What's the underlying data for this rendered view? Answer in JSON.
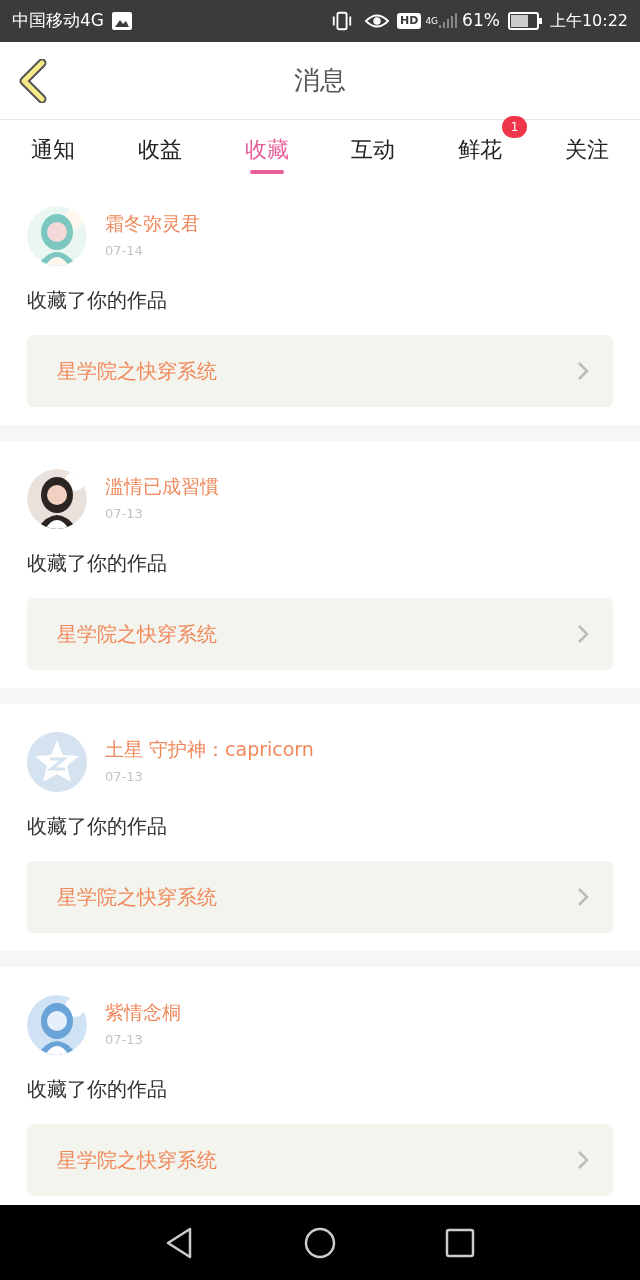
{
  "status_bar": {
    "carrier": "中国移动4G",
    "hd": "HD",
    "network": "4G",
    "battery": "61%",
    "time": "上午10:22"
  },
  "header": {
    "title": "消息"
  },
  "tabs": [
    {
      "label": "通知",
      "selected": false
    },
    {
      "label": "收益",
      "selected": false
    },
    {
      "label": "收藏",
      "selected": true
    },
    {
      "label": "互动",
      "selected": false
    },
    {
      "label": "鲜花",
      "selected": false,
      "badge": "1"
    },
    {
      "label": "关注",
      "selected": false
    }
  ],
  "messages": [
    {
      "name": "霜冬弥灵君",
      "date": "07-14",
      "text": "收藏了你的作品",
      "work": "星学院之快穿系统"
    },
    {
      "name": "滥情已成習慣",
      "date": "07-13",
      "text": "收藏了你的作品",
      "work": "星学院之快穿系统"
    },
    {
      "avatar": {
        "kind": "default"
      },
      "name": "土星 守护神：capricorn",
      "date": "07-13",
      "text": "收藏了你的作品",
      "work": "星学院之快穿系统"
    },
    {
      "name": "紫情念桐",
      "date": "07-13",
      "text": "收藏了你的作品",
      "work": "星学院之快穿系统"
    }
  ]
}
